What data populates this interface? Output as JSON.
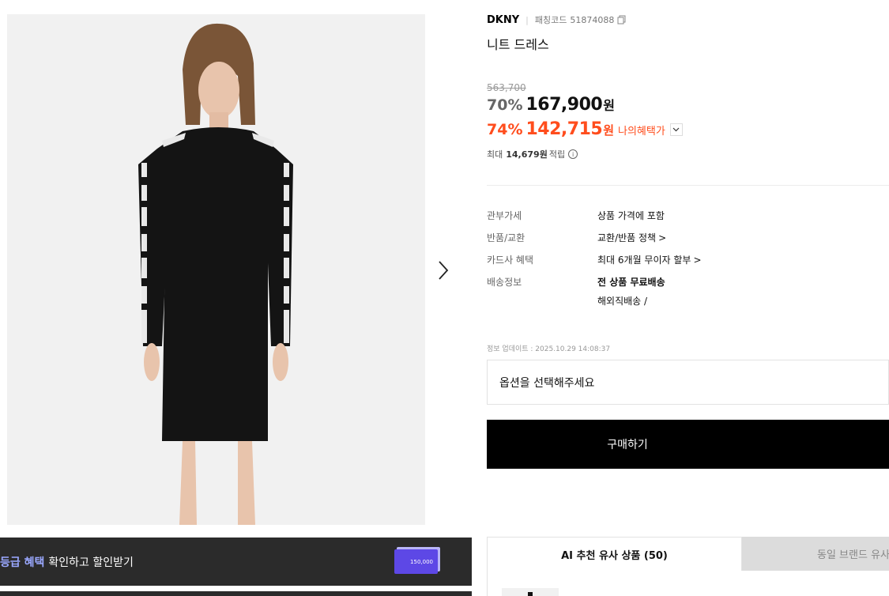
{
  "product": {
    "brand": "DKNY",
    "code_label": "패칭코드",
    "code": "51874088",
    "name": "니트 드레스",
    "original_price": "563,700",
    "discount_rate": "70%",
    "price": "167,900",
    "currency": "원",
    "member_discount_rate": "74%",
    "member_price": "142,715",
    "benefit_label": "나의혜택가",
    "points_prefix": "최대",
    "points_amount": "14,679원",
    "points_suffix": "적립"
  },
  "details": [
    {
      "label": "관부가세",
      "value": "상품 가격에 포함"
    },
    {
      "label": "반품/교환",
      "value": "교환/반품 정책"
    },
    {
      "label": "카드사 혜택",
      "value": "최대 6개월 무이자 할부"
    },
    {
      "label": "배송정보",
      "value": "전 상품 무료배송",
      "value2": "해외직배송 /"
    }
  ],
  "update_text": "정보 업데이트 : 2025.10.29 14:08:37",
  "option_placeholder": "옵션을 선택해주세요",
  "buy_label": "구매하기",
  "banner": {
    "highlight": "등급 혜택",
    "text": "확인하고 할인받기",
    "card_amount": "150,000"
  },
  "tabs": [
    {
      "label": "AI 추천 유사 상품 (50)",
      "active": true
    },
    {
      "label": "동일 브랜드 유사 상",
      "active": false
    }
  ],
  "icons": [
    "copy-icon",
    "chevron-down-icon",
    "info-icon",
    "chevron-right-icon",
    "next-image-arrow-icon"
  ],
  "colors": {
    "accent": "#ff4d1d",
    "buy_button": "#000000",
    "banner_bg": "#2b2b2b",
    "banner_highlight": "#9aa8ff",
    "card": "#5d48e6"
  }
}
